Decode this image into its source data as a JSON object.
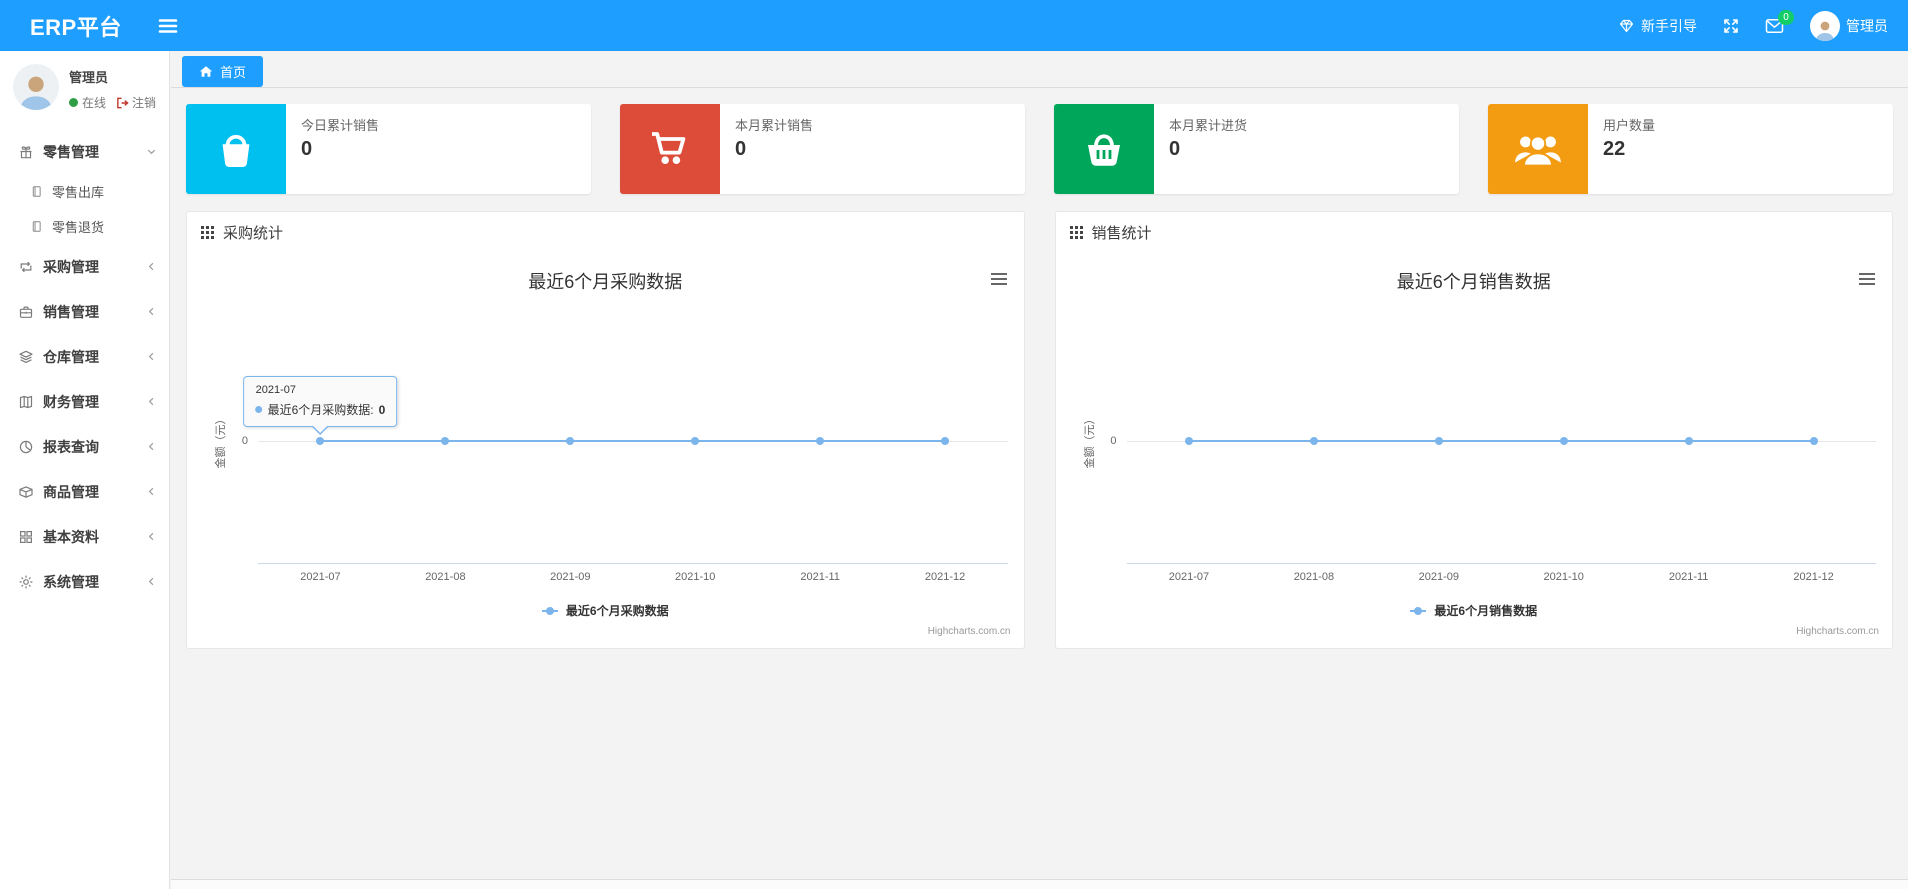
{
  "app": {
    "name": "ERP平台"
  },
  "header": {
    "guide_label": "新手引导",
    "mail_badge": "0",
    "user_name": "管理员",
    "icons": [
      "menu-icon",
      "gem-icon",
      "fullscreen-icon",
      "mail-icon",
      "avatar"
    ]
  },
  "sidebar": {
    "user": {
      "name": "管理员",
      "online_label": "在线",
      "logout_label": "注销"
    },
    "menus": [
      {
        "label": "零售管理",
        "icon": "gift-icon",
        "state": "expanded",
        "children": [
          {
            "label": "零售出库",
            "icon": "document-icon"
          },
          {
            "label": "零售退货",
            "icon": "document-icon"
          }
        ]
      },
      {
        "label": "采购管理",
        "icon": "repeat-icon"
      },
      {
        "label": "销售管理",
        "icon": "briefcase-icon"
      },
      {
        "label": "仓库管理",
        "icon": "layers-icon"
      },
      {
        "label": "财务管理",
        "icon": "ledger-icon"
      },
      {
        "label": "报表查询",
        "icon": "pie-clock-icon"
      },
      {
        "label": "商品管理",
        "icon": "box-icon"
      },
      {
        "label": "基本资料",
        "icon": "grid-icon"
      },
      {
        "label": "系统管理",
        "icon": "gear-icon"
      }
    ]
  },
  "tabs": [
    {
      "label": "首页",
      "icon": "home-icon",
      "active": true
    }
  ],
  "stat_cards": [
    {
      "label": "今日累计销售",
      "value": "0",
      "color": "#00c0ef",
      "icon": "shopping-bag-icon"
    },
    {
      "label": "本月累计销售",
      "value": "0",
      "color": "#dd4b39",
      "icon": "cart-icon"
    },
    {
      "label": "本月累计进货",
      "value": "0",
      "color": "#00a65a",
      "icon": "basket-icon"
    },
    {
      "label": "用户数量",
      "value": "22",
      "color": "#f39c12",
      "icon": "users-icon"
    }
  ],
  "panels": [
    {
      "title": "采购统计",
      "icon": "grid-dots-icon"
    },
    {
      "title": "销售统计",
      "icon": "grid-dots-icon"
    }
  ],
  "chart_data": [
    {
      "type": "line",
      "title": "最近6个月采购数据",
      "categories": [
        "2021-07",
        "2021-08",
        "2021-09",
        "2021-10",
        "2021-11",
        "2021-12"
      ],
      "series": [
        {
          "name": "最近6个月采购数据",
          "values": [
            0,
            0,
            0,
            0,
            0,
            0
          ],
          "color": "#7cb5ec"
        }
      ],
      "xlabel": "",
      "ylabel": "金额（元）",
      "yticks": [
        "0"
      ],
      "grid": "zero-line-only",
      "legend_position": "bottom",
      "credit": "Highcharts.com.cn",
      "tooltip": {
        "date": "2021-07",
        "series_label": "最近6个月采购数据: ",
        "value": "0"
      }
    },
    {
      "type": "line",
      "title": "最近6个月销售数据",
      "categories": [
        "2021-07",
        "2021-08",
        "2021-09",
        "2021-10",
        "2021-11",
        "2021-12"
      ],
      "series": [
        {
          "name": "最近6个月销售数据",
          "values": [
            0,
            0,
            0,
            0,
            0,
            0
          ],
          "color": "#7cb5ec"
        }
      ],
      "xlabel": "",
      "ylabel": "金额（元）",
      "yticks": [
        "0"
      ],
      "grid": "zero-line-only",
      "legend_position": "bottom",
      "credit": "Highcharts.com.cn"
    }
  ],
  "colors": {
    "header": "#1e9fff",
    "series": "#7cb5ec",
    "badge": "#13ce66"
  }
}
